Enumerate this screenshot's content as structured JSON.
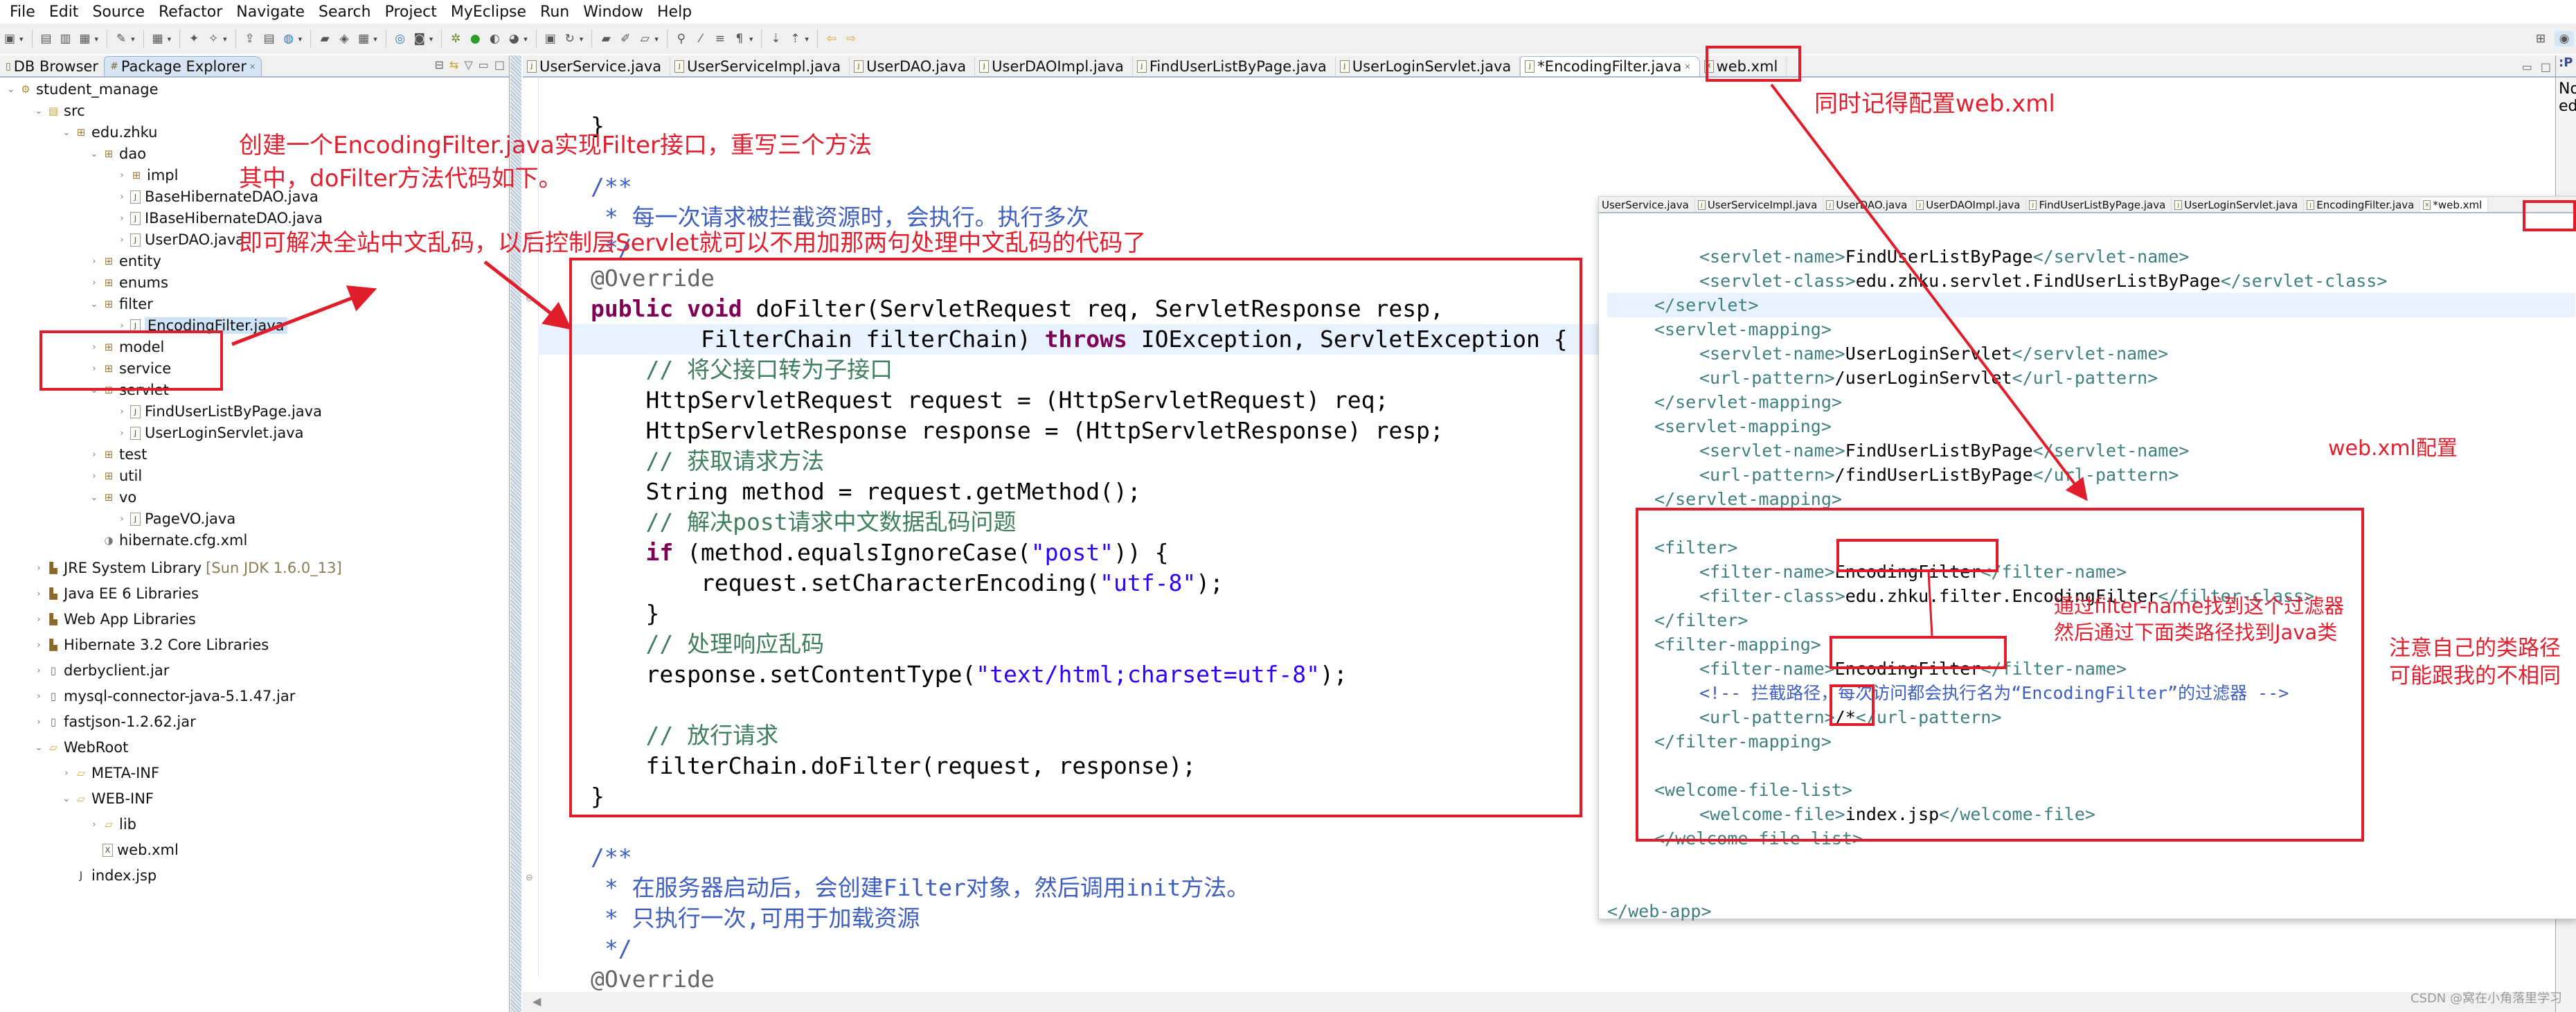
{
  "menu": [
    "File",
    "Edit",
    "Source",
    "Refactor",
    "Navigate",
    "Search",
    "Project",
    "MyEclipse",
    "Run",
    "Window",
    "Help"
  ],
  "toolbar": {
    "icons": [
      "new-icon",
      "save-icon",
      "save-all-icon",
      "print-icon",
      "tool-icon",
      "calc-icon",
      "wizard-icon",
      "wizard2-icon",
      "deploy-icon",
      "server-icon",
      "globe-icon",
      "open-folder-icon",
      "open-type-icon",
      "report-icon",
      "web-icon",
      "camera-icon",
      "debug-icon",
      "run-icon",
      "run-config-icon",
      "external-tool-icon",
      "server-run-icon",
      "refresh-icon",
      "open-icon",
      "edit-icon",
      "open-file-icon",
      "pin-icon",
      "mark-icon",
      "list-icon",
      "para-icon",
      "next-annotation-icon",
      "prev-annotation-icon",
      "back-icon",
      "forward-icon"
    ],
    "right_icons": [
      "open-perspective-icon",
      "myeclipse-perspective-icon"
    ]
  },
  "explorer": {
    "tabs": [
      {
        "label": "DB Browser",
        "icon": "db-browser-icon",
        "active": false
      },
      {
        "label": "Package Explorer",
        "icon": "package-explorer-icon",
        "active": true
      }
    ],
    "tools": [
      "collapse-all-icon",
      "link-editor-icon",
      "view-menu-icon",
      "minimize-icon",
      "maximize-icon"
    ],
    "tree": [
      {
        "label": "student_manage",
        "depth": 0,
        "expanded": true,
        "icon": "project-icon"
      },
      {
        "label": "src",
        "depth": 1,
        "expanded": true,
        "icon": "source-folder-icon"
      },
      {
        "label": "edu.zhku",
        "depth": 2,
        "expanded": true,
        "icon": "package-icon"
      },
      {
        "label": "dao",
        "depth": 3,
        "expanded": true,
        "icon": "package-icon"
      },
      {
        "label": "impl",
        "depth": 4,
        "expanded": false,
        "icon": "package-icon"
      },
      {
        "label": "BaseHibernateDAO.java",
        "depth": 4,
        "expanded": false,
        "icon": "java-file-icon"
      },
      {
        "label": "IBaseHibernateDAO.java",
        "depth": 4,
        "expanded": false,
        "icon": "java-file-icon"
      },
      {
        "label": "UserDAO.java",
        "depth": 4,
        "expanded": false,
        "icon": "java-file-icon"
      },
      {
        "label": "entity",
        "depth": 3,
        "expanded": false,
        "icon": "package-icon"
      },
      {
        "label": "enums",
        "depth": 3,
        "expanded": false,
        "icon": "package-icon"
      },
      {
        "label": "filter",
        "depth": 3,
        "expanded": true,
        "icon": "package-icon"
      },
      {
        "label": "EncodingFilter.java",
        "depth": 4,
        "expanded": false,
        "icon": "java-file-icon",
        "selected": true
      },
      {
        "label": "model",
        "depth": 3,
        "expanded": false,
        "icon": "package-icon"
      },
      {
        "label": "service",
        "depth": 3,
        "expanded": false,
        "icon": "package-icon"
      },
      {
        "label": "servlet",
        "depth": 3,
        "expanded": true,
        "icon": "package-icon"
      },
      {
        "label": "FindUserListByPage.java",
        "depth": 4,
        "expanded": false,
        "icon": "java-file-icon"
      },
      {
        "label": "UserLoginServlet.java",
        "depth": 4,
        "expanded": false,
        "icon": "java-file-icon"
      },
      {
        "label": "test",
        "depth": 3,
        "expanded": false,
        "icon": "package-icon"
      },
      {
        "label": "util",
        "depth": 3,
        "expanded": false,
        "icon": "package-icon"
      },
      {
        "label": "vo",
        "depth": 3,
        "expanded": true,
        "icon": "package-icon"
      },
      {
        "label": "PageVO.java",
        "depth": 4,
        "expanded": false,
        "icon": "java-file-icon"
      },
      {
        "label": "hibernate.cfg.xml",
        "depth": 3,
        "leaf": true,
        "icon": "hibernate-config-icon"
      },
      {
        "label": "JRE System Library",
        "decoration": "[Sun JDK 1.6.0_13]",
        "depth": 1,
        "expanded": false,
        "icon": "library-icon"
      },
      {
        "label": "Java EE 6 Libraries",
        "depth": 1,
        "expanded": false,
        "icon": "library-icon"
      },
      {
        "label": "Web App Libraries",
        "depth": 1,
        "expanded": false,
        "icon": "library-icon"
      },
      {
        "label": "Hibernate 3.2 Core Libraries",
        "depth": 1,
        "expanded": false,
        "icon": "library-icon"
      },
      {
        "label": "derbyclient.jar",
        "depth": 1,
        "expanded": false,
        "icon": "jar-icon"
      },
      {
        "label": "mysql-connector-java-5.1.47.jar",
        "depth": 1,
        "expanded": false,
        "icon": "jar-icon"
      },
      {
        "label": "fastjson-1.2.62.jar",
        "depth": 1,
        "expanded": false,
        "icon": "jar-icon"
      },
      {
        "label": "WebRoot",
        "depth": 1,
        "expanded": true,
        "icon": "folder-icon"
      },
      {
        "label": "META-INF",
        "depth": 2,
        "expanded": false,
        "icon": "folder-icon"
      },
      {
        "label": "WEB-INF",
        "depth": 2,
        "expanded": true,
        "icon": "folder-icon"
      },
      {
        "label": "lib",
        "depth": 3,
        "expanded": false,
        "icon": "folder-icon"
      },
      {
        "label": "web.xml",
        "depth": 3,
        "leaf": true,
        "icon": "xml-file-icon"
      },
      {
        "label": "index.jsp",
        "depth": 2,
        "leaf": true,
        "icon": "jsp-file-icon"
      }
    ]
  },
  "editor": {
    "tabs": [
      {
        "label": "UserService.java",
        "active": false
      },
      {
        "label": "UserServiceImpl.java",
        "active": false
      },
      {
        "label": "UserDAO.java",
        "active": false
      },
      {
        "label": "UserDAOImpl.java",
        "active": false
      },
      {
        "label": "FindUserListByPage.java",
        "active": false
      },
      {
        "label": "UserLoginServlet.java",
        "active": false
      },
      {
        "label": "*EncodingFilter.java",
        "active": true,
        "closable": true
      },
      {
        "label": "web.xml",
        "active": false
      }
    ],
    "lines": [
      {
        "indent": 0,
        "parts": [
          {
            "t": "}",
            "c": "txt"
          }
        ]
      },
      {
        "indent": 0,
        "parts": []
      },
      {
        "indent": 0,
        "parts": [
          {
            "t": "/**",
            "c": "jd"
          }
        ]
      },
      {
        "indent": 0,
        "parts": [
          {
            "t": " * 每一次请求被拦截资源时，会执行。执行多次",
            "c": "jd"
          }
        ]
      },
      {
        "indent": 0,
        "parts": [
          {
            "t": " */",
            "c": "jd"
          }
        ]
      },
      {
        "indent": 0,
        "parts": [
          {
            "t": "@Override",
            "c": "ann"
          }
        ]
      },
      {
        "indent": 0,
        "parts": [
          {
            "t": "public",
            "c": "kw"
          },
          {
            "t": " "
          },
          {
            "t": "void",
            "c": "kw"
          },
          {
            "t": " doFilter(ServletRequest req, ServletResponse resp,"
          }
        ]
      },
      {
        "indent": 0,
        "highlight": true,
        "parts": [
          {
            "t": "        FilterChain filterChain) "
          },
          {
            "t": "throws",
            "c": "kw"
          },
          {
            "t": " IOException, ServletException {"
          }
        ]
      },
      {
        "indent": 0,
        "parts": [
          {
            "t": "    "
          },
          {
            "t": "// 将父接口转为子接口",
            "c": "cm"
          }
        ]
      },
      {
        "indent": 0,
        "parts": [
          {
            "t": "    HttpServletRequest request = (HttpServletRequest) req;"
          }
        ]
      },
      {
        "indent": 0,
        "parts": [
          {
            "t": "    HttpServletResponse response = (HttpServletResponse) resp;"
          }
        ]
      },
      {
        "indent": 0,
        "parts": [
          {
            "t": "    "
          },
          {
            "t": "// 获取请求方法",
            "c": "cm"
          }
        ]
      },
      {
        "indent": 0,
        "parts": [
          {
            "t": "    String method = request.getMethod();"
          }
        ]
      },
      {
        "indent": 0,
        "parts": [
          {
            "t": "    "
          },
          {
            "t": "// 解决post请求中文数据乱码问题",
            "c": "cm"
          }
        ]
      },
      {
        "indent": 0,
        "parts": [
          {
            "t": "    "
          },
          {
            "t": "if",
            "c": "kw"
          },
          {
            "t": " (method.equalsIgnoreCase("
          },
          {
            "t": "\"post\"",
            "c": "str"
          },
          {
            "t": ")) {"
          }
        ]
      },
      {
        "indent": 0,
        "parts": [
          {
            "t": "        request.setCharacterEncoding("
          },
          {
            "t": "\"utf-8\"",
            "c": "str"
          },
          {
            "t": ");"
          }
        ]
      },
      {
        "indent": 0,
        "parts": [
          {
            "t": "    }"
          }
        ]
      },
      {
        "indent": 0,
        "parts": [
          {
            "t": "    "
          },
          {
            "t": "// 处理响应乱码",
            "c": "cm"
          }
        ]
      },
      {
        "indent": 0,
        "parts": [
          {
            "t": "    response.setContentType("
          },
          {
            "t": "\"text/html;charset=utf-8\"",
            "c": "str"
          },
          {
            "t": ");"
          }
        ]
      },
      {
        "indent": 0,
        "parts": []
      },
      {
        "indent": 0,
        "parts": [
          {
            "t": "    "
          },
          {
            "t": "// 放行请求",
            "c": "cm"
          }
        ]
      },
      {
        "indent": 0,
        "parts": [
          {
            "t": "    filterChain.doFilter(request, response);"
          }
        ]
      },
      {
        "indent": 0,
        "parts": [
          {
            "t": "}"
          }
        ]
      },
      {
        "indent": 0,
        "parts": []
      },
      {
        "indent": 0,
        "parts": [
          {
            "t": "/**",
            "c": "jd"
          }
        ]
      },
      {
        "indent": 0,
        "parts": [
          {
            "t": " * 在服务器启动后，会创建Filter对象，然后调用init方法。",
            "c": "jd"
          }
        ]
      },
      {
        "indent": 0,
        "parts": [
          {
            "t": " * 只执行一次,可用于加载资源",
            "c": "jd"
          }
        ]
      },
      {
        "indent": 0,
        "parts": [
          {
            "t": " */",
            "c": "jd"
          }
        ]
      },
      {
        "indent": 0,
        "parts": [
          {
            "t": "@Override",
            "c": "ann"
          }
        ]
      }
    ]
  },
  "xml_panel": {
    "tabs": [
      {
        "label": "UserService.java",
        "active": false
      },
      {
        "label": "UserServiceImpl.java",
        "active": false
      },
      {
        "label": "UserDAO.java",
        "active": false
      },
      {
        "label": "UserDAOImpl.java",
        "active": false
      },
      {
        "label": "FindUserListByPage.java",
        "active": false
      },
      {
        "label": "UserLoginServlet.java",
        "active": false
      },
      {
        "label": "EncodingFilter.java",
        "active": false
      },
      {
        "label": "*web.xml",
        "active": true
      }
    ],
    "lines": [
      {
        "indent": 1,
        "parts": [
          {
            "t": "<servlet-name>",
            "c": "tag"
          },
          {
            "t": "FindUserListByPage",
            "c": "txt"
          },
          {
            "t": "</servlet-name>",
            "c": "tag"
          }
        ]
      },
      {
        "indent": 1,
        "parts": [
          {
            "t": "<servlet-class>",
            "c": "tag"
          },
          {
            "t": "edu.zhku.servlet.FindUserListByPage",
            "c": "txt"
          },
          {
            "t": "</servlet-class>",
            "c": "tag"
          }
        ]
      },
      {
        "indent": 0,
        "highlight": true,
        "parts": [
          {
            "t": "</servlet>",
            "c": "tag"
          }
        ]
      },
      {
        "indent": 0,
        "parts": [
          {
            "t": "<servlet-mapping>",
            "c": "tag"
          }
        ]
      },
      {
        "indent": 1,
        "parts": [
          {
            "t": "<servlet-name>",
            "c": "tag"
          },
          {
            "t": "UserLoginServlet",
            "c": "txt"
          },
          {
            "t": "</servlet-name>",
            "c": "tag"
          }
        ]
      },
      {
        "indent": 1,
        "parts": [
          {
            "t": "<url-pattern>",
            "c": "tag"
          },
          {
            "t": "/userLoginServlet",
            "c": "txt"
          },
          {
            "t": "</url-pattern>",
            "c": "tag"
          }
        ]
      },
      {
        "indent": 0,
        "parts": [
          {
            "t": "</servlet-mapping>",
            "c": "tag"
          }
        ]
      },
      {
        "indent": 0,
        "parts": [
          {
            "t": "<servlet-mapping>",
            "c": "tag"
          }
        ]
      },
      {
        "indent": 1,
        "parts": [
          {
            "t": "<servlet-name>",
            "c": "tag"
          },
          {
            "t": "FindUserListByPage",
            "c": "txt"
          },
          {
            "t": "</servlet-name>",
            "c": "tag"
          }
        ]
      },
      {
        "indent": 1,
        "parts": [
          {
            "t": "<url-pattern>",
            "c": "tag"
          },
          {
            "t": "/findUserListByPage",
            "c": "txt"
          },
          {
            "t": "</url-pattern>",
            "c": "tag"
          }
        ]
      },
      {
        "indent": 0,
        "parts": [
          {
            "t": "</servlet-mapping>",
            "c": "tag"
          }
        ]
      },
      {
        "indent": 0,
        "parts": []
      },
      {
        "indent": 0,
        "parts": [
          {
            "t": "<filter>",
            "c": "tag"
          }
        ]
      },
      {
        "indent": 1,
        "parts": [
          {
            "t": "<filter-name>",
            "c": "tag"
          },
          {
            "t": "EncodingFilter",
            "c": "txt"
          },
          {
            "t": "</filter-name>",
            "c": "tag"
          }
        ]
      },
      {
        "indent": 1,
        "parts": [
          {
            "t": "<filter-class>",
            "c": "tag"
          },
          {
            "t": "edu.zhku.filter.EncodingFilter",
            "c": "txt"
          },
          {
            "t": "</filter-class>",
            "c": "tag"
          }
        ]
      },
      {
        "indent": 0,
        "parts": [
          {
            "t": "</filter>",
            "c": "tag"
          }
        ]
      },
      {
        "indent": 0,
        "parts": [
          {
            "t": "<filter-mapping>",
            "c": "tag"
          }
        ]
      },
      {
        "indent": 1,
        "parts": [
          {
            "t": "<filter-name>",
            "c": "tag"
          },
          {
            "t": "EncodingFilter",
            "c": "txt"
          },
          {
            "t": "</filter-name>",
            "c": "tag"
          }
        ]
      },
      {
        "indent": 1,
        "parts": [
          {
            "t": "<!-- 拦截路径，每次访问都会执行名为“EncodingFilter”的过滤器 -->",
            "c": "xcm"
          }
        ]
      },
      {
        "indent": 1,
        "parts": [
          {
            "t": "<url-pattern>",
            "c": "tag"
          },
          {
            "t": "/*",
            "c": "txt"
          },
          {
            "t": "</url-pattern>",
            "c": "tag"
          }
        ]
      },
      {
        "indent": 0,
        "parts": [
          {
            "t": "</filter-mapping>",
            "c": "tag"
          }
        ]
      },
      {
        "indent": 0,
        "parts": []
      },
      {
        "indent": 0,
        "parts": [
          {
            "t": "<welcome-file-list>",
            "c": "tag"
          }
        ]
      },
      {
        "indent": 1,
        "parts": [
          {
            "t": "<welcome-file>",
            "c": "tag"
          },
          {
            "t": "index.jsp",
            "c": "txt"
          },
          {
            "t": "</welcome-file>",
            "c": "tag"
          }
        ]
      },
      {
        "indent": 0,
        "parts": [
          {
            "t": "</welcome-file-list>",
            "c": "tag"
          }
        ]
      },
      {
        "indent": 0,
        "parts": []
      },
      {
        "indent": 0,
        "parts": []
      },
      {
        "indent": -1,
        "parts": [
          {
            "t": "</web-app>",
            "c": "tag"
          }
        ]
      }
    ]
  },
  "outline": {
    "label_lines": [
      "No",
      "edi"
    ]
  },
  "annotations": {
    "create_filter_line1": "创建一个EncodingFilter.java实现Filter接口，重写三个方法",
    "create_filter_line2": "其中，doFilter方法代码如下。",
    "solve_encoding": "即可解决全站中文乱码，以后控制层Servlet就可以不用加那两句处理中文乱码的代码了",
    "remember_webxml": "同时记得配置web.xml",
    "webxml_config": "web.xml配置",
    "filter_name_line1": "通过filter-name找到这个过滤器",
    "filter_name_line2": "然后通过下面类路径找到Java类",
    "classpath_note_line1": "注意自己的类路径",
    "classpath_note_line2": "可能跟我的不相同",
    "color": "#e0202e"
  },
  "watermark": "CSDN @窝在小角落里学习"
}
